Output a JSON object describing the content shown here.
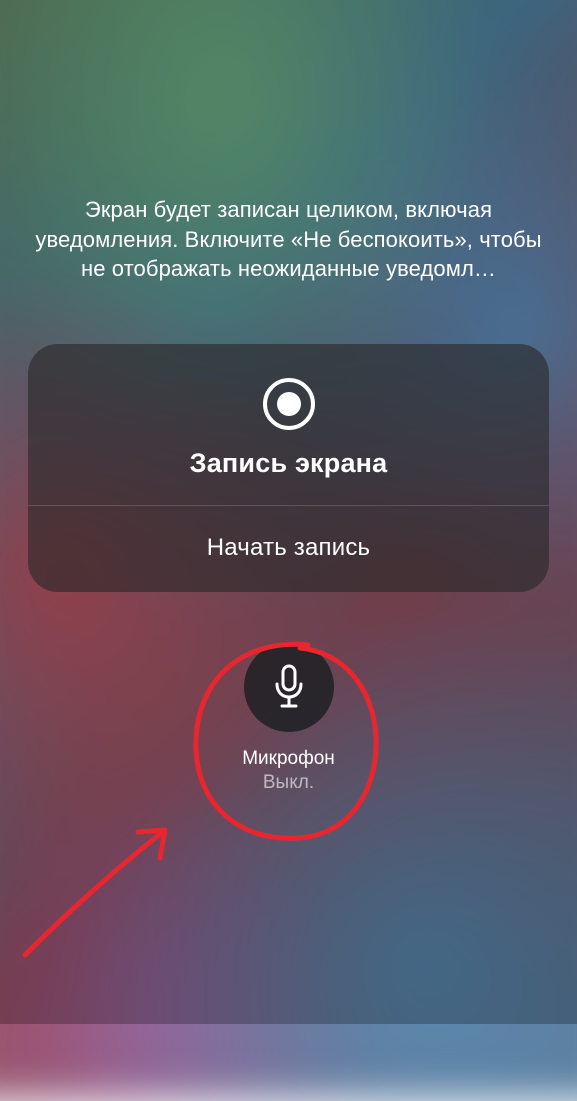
{
  "description": "Экран будет записан целиком, включая уведомления. Включите «Не беспокоить», чтобы не отображать неожиданные уведомл…",
  "panel": {
    "title": "Запись экрана",
    "start_label": "Начать запись"
  },
  "microphone": {
    "label": "Микрофон",
    "status": "Выкл."
  }
}
